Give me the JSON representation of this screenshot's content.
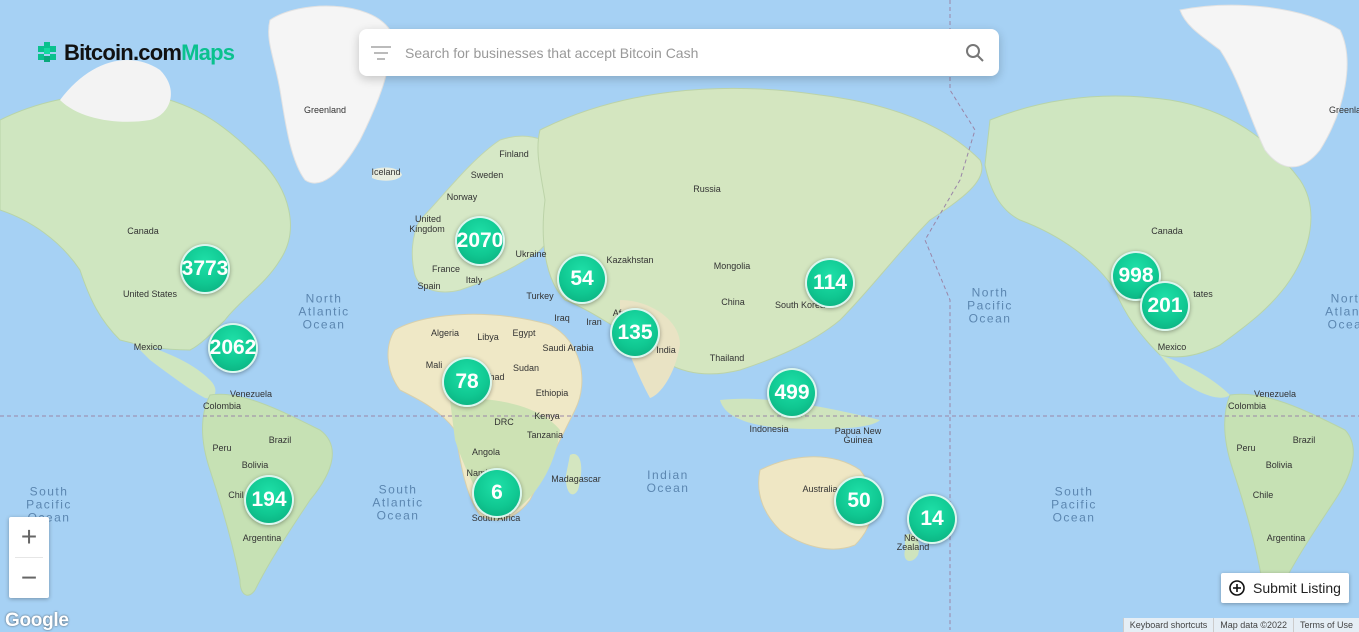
{
  "app": {
    "logo_text_1": "Bitcoin.com",
    "logo_text_2": "Maps",
    "brand_color": "#0ac18e"
  },
  "search": {
    "placeholder": "Search for businesses that accept Bitcoin Cash",
    "filter_icon": "filter-icon",
    "search_icon": "search-icon"
  },
  "clusters": [
    {
      "id": "na-east",
      "count": "3773"
    },
    {
      "id": "caribbean",
      "count": "2062"
    },
    {
      "id": "south-america",
      "count": "194"
    },
    {
      "id": "europe",
      "count": "2070"
    },
    {
      "id": "middle-east",
      "count": "54"
    },
    {
      "id": "south-asia",
      "count": "135"
    },
    {
      "id": "west-africa",
      "count": "78"
    },
    {
      "id": "southern-africa",
      "count": "6"
    },
    {
      "id": "east-asia",
      "count": "114"
    },
    {
      "id": "southeast-asia",
      "count": "499"
    },
    {
      "id": "australia",
      "count": "50"
    },
    {
      "id": "new-zealand",
      "count": "14"
    },
    {
      "id": "na-west",
      "count": "998"
    },
    {
      "id": "mexico",
      "count": "201"
    }
  ],
  "labels": {
    "greenland": "Greenland",
    "greenland_right": "Greenla",
    "iceland": "Iceland",
    "finland": "Finland",
    "sweden": "Sweden",
    "norway": "Norway",
    "united_kingdom_1": "United",
    "united_kingdom_2": "Kingdom",
    "france": "France",
    "spain": "Spain",
    "italy": "Italy",
    "ukraine": "Ukraine",
    "russia": "Russia",
    "kazakhstan": "Kazakhstan",
    "mongolia": "Mongolia",
    "china": "China",
    "south_korea": "South Korea",
    "turkey": "Turkey",
    "iraq": "Iraq",
    "iran": "Iran",
    "afghanistan": "Afgh",
    "india": "India",
    "thailand": "Thailand",
    "algeria": "Algeria",
    "libya": "Libya",
    "egypt": "Egypt",
    "saudi_arabia": "Saudi Arabia",
    "mali": "Mali",
    "chad": "had",
    "sudan": "Sudan",
    "ethiopia": "Ethiopia",
    "kenya": "Kenya",
    "drc": "DRC",
    "tanzania": "Tanzania",
    "angola": "Angola",
    "namibia": "Nami",
    "south_africa": "South Africa",
    "madagascar": "Madagascar",
    "indonesia": "Indonesia",
    "papua_1": "Papua New",
    "papua_2": "Guinea",
    "australia": "Australia",
    "new_zealand_1": "New",
    "new_zealand_2": "Zealand",
    "canada": "Canada",
    "canada_right": "Canada",
    "united_states": "United States",
    "united_states_right": "tates",
    "mexico": "Mexico",
    "mexico_right": "Mexico",
    "venezuela": "Venezuela",
    "venezuela_right": "Venezuela",
    "colombia": "Colombia",
    "colombia_right": "Colombia",
    "peru": "Peru",
    "peru_right": "Peru",
    "brazil": "Brazil",
    "brazil_right": "Brazil",
    "bolivia": "Bolivia",
    "bolivia_right": "Bolivia",
    "chile": "Chil",
    "chile_right": "Chile",
    "argentina": "Argentina",
    "argentina_right": "Argentina"
  },
  "oceans": {
    "north_atlantic": "North\nAtlantic\nOcean",
    "north_pacific": "North\nPacific\nOcean",
    "north_atlantic_right": "Nort\nAtlant\nOcea",
    "south_atlantic": "South\nAtlantic\nOcean",
    "south_pacific_left": "South\nPacific\nOcean",
    "south_pacific_right": "South\nPacific\nOcean",
    "indian": "Indian\nOcean"
  },
  "controls": {
    "zoom_in": "+",
    "zoom_out": "−",
    "submit_label": "Submit Listing",
    "google": "Google"
  },
  "footer": {
    "shortcuts": "Keyboard shortcuts",
    "map_data": "Map data ©2022",
    "terms": "Terms of Use"
  }
}
